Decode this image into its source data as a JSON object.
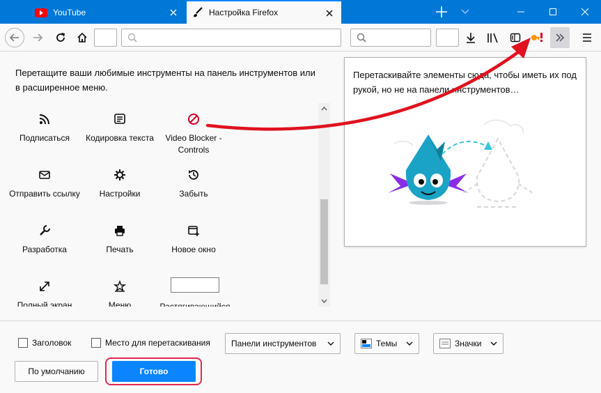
{
  "tabs": [
    {
      "label": "YouTube"
    },
    {
      "label": "Настройка Firefox"
    }
  ],
  "instructions": "Перетащите ваши любимые инструменты на панель инструментов или в расширенное меню.",
  "palette": [
    {
      "name": "palette-item-subscribe",
      "icon": "rss-icon",
      "label": "Подписаться"
    },
    {
      "name": "palette-item-encoding",
      "icon": "text-encoding-icon",
      "label": "Кодировка текста"
    },
    {
      "name": "palette-item-video-blocker",
      "icon": "video-blocker-icon",
      "label": "Video Blocker - Controls"
    },
    {
      "name": "palette-item-email-link",
      "icon": "mail-icon",
      "label": "Отправить ссылку"
    },
    {
      "name": "palette-item-preferences",
      "icon": "gear-icon",
      "label": "Настройки"
    },
    {
      "name": "palette-item-forget",
      "icon": "history-icon",
      "label": "Забыть"
    },
    {
      "name": "palette-item-developer",
      "icon": "wrench-icon",
      "label": "Разработка"
    },
    {
      "name": "palette-item-print",
      "icon": "printer-icon",
      "label": "Печать"
    },
    {
      "name": "palette-item-new-window",
      "icon": "new-window-icon",
      "label": "Новое окно"
    },
    {
      "name": "palette-item-fullscreen",
      "icon": "fullscreen-icon",
      "label": "Полный экран"
    },
    {
      "name": "palette-item-menu",
      "icon": "star-box-icon",
      "label": "Меню"
    },
    {
      "name": "palette-item-flexible-space",
      "icon": "flexible-space-box",
      "label": "Растягивающийся"
    }
  ],
  "overflow_panel": {
    "text": "Перетаскивайте элементы сюда, чтобы иметь их под рукой, но не на панели инструментов…"
  },
  "footer": {
    "titlebar_label": "Заголовок",
    "drag_space_label": "Место для перетаскивания",
    "toolbars_label": "Панели инструментов",
    "themes_label": "Темы",
    "density_label": "Значки",
    "restore_label": "По умолчанию",
    "done_label": "Готово"
  },
  "colors": {
    "titlebar": "#0078d7",
    "accent": "#0a84ff",
    "highlight": "#e22850",
    "arrow": "#e0121e"
  }
}
